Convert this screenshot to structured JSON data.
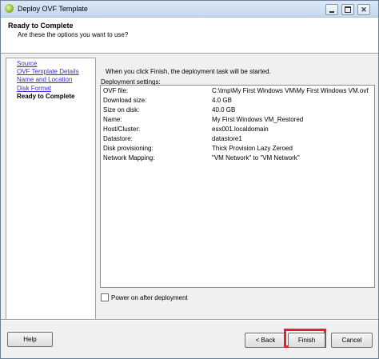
{
  "window": {
    "title": "Deploy OVF Template",
    "icon": "vsphere-app-icon"
  },
  "header": {
    "title": "Ready to Complete",
    "subtitle": "Are these the options you want to use?"
  },
  "steps": [
    {
      "label": "Source"
    },
    {
      "label": "OVF Template Details"
    },
    {
      "label": "Name and Location"
    },
    {
      "label": "Disk Format"
    },
    {
      "label": "Ready to Complete"
    }
  ],
  "intro": "When you click Finish, the deployment task will be started.",
  "settings_label": "Deployment settings:",
  "settings": [
    {
      "key": "OVF file:",
      "value": "C:\\tmp\\My First Windows VM\\My First Windows VM.ovf"
    },
    {
      "key": "Download size:",
      "value": "4.0 GB"
    },
    {
      "key": "Size on disk:",
      "value": "40.0 GB"
    },
    {
      "key": "Name:",
      "value": "My First Windows VM_Restored"
    },
    {
      "key": "Host/Cluster:",
      "value": "esx001.localdomain"
    },
    {
      "key": "Datastore:",
      "value": "datastore1"
    },
    {
      "key": "Disk provisioning:",
      "value": "Thick Provision Lazy Zeroed"
    },
    {
      "key": "Network Mapping:",
      "value": "\"VM Network\" to \"VM Network\""
    }
  ],
  "power_on": {
    "label": "Power on after deployment",
    "checked": false
  },
  "buttons": {
    "help": "Help",
    "back": "< Back",
    "finish": "Finish",
    "cancel": "Cancel"
  },
  "colors": {
    "link": "#3a2fd6",
    "highlight": "#e5202a"
  }
}
